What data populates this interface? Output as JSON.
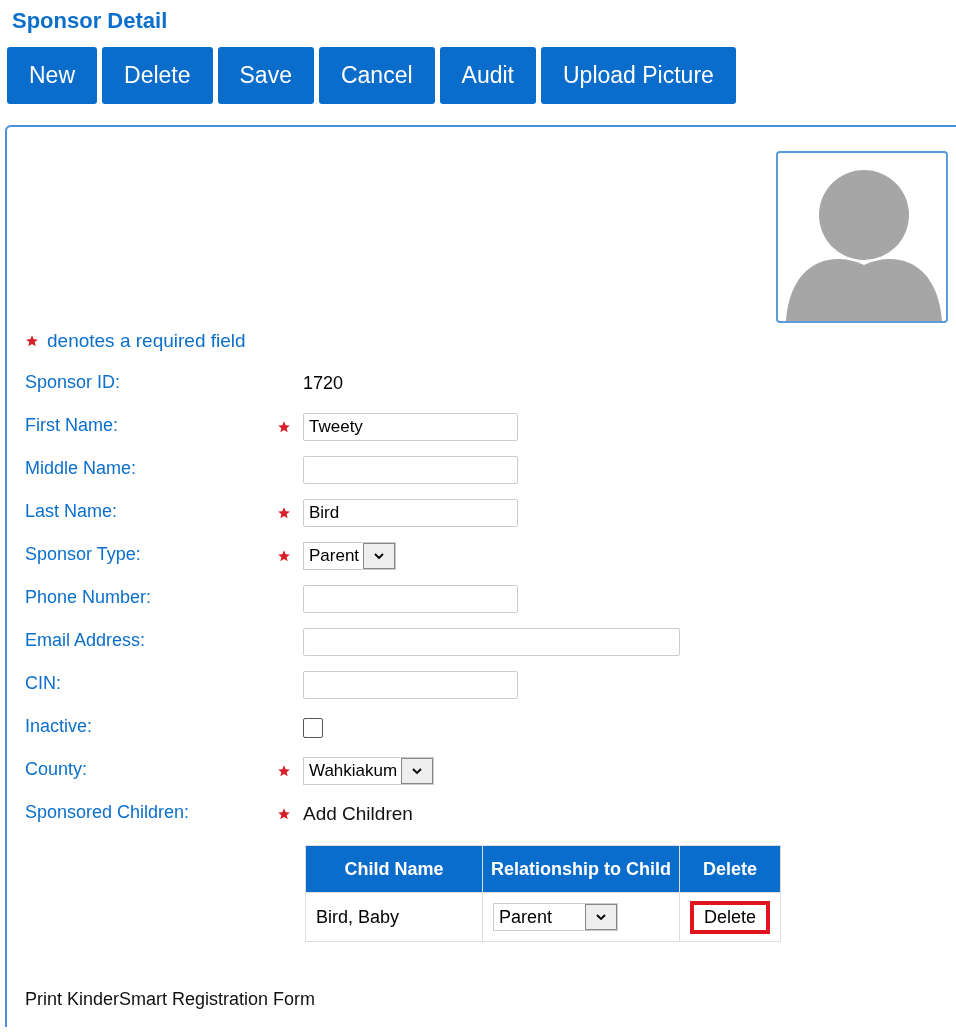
{
  "title": "Sponsor Detail",
  "toolbar": [
    "New",
    "Delete",
    "Save",
    "Cancel",
    "Audit",
    "Upload Picture"
  ],
  "required_note": "denotes a required field",
  "fields": [
    {
      "label": "Sponsor ID:",
      "kind": "static",
      "required": false,
      "value": "1720"
    },
    {
      "label": "First Name:",
      "kind": "text",
      "required": true,
      "value": "Tweety"
    },
    {
      "label": "Middle Name:",
      "kind": "text",
      "required": false
    },
    {
      "label": "Last Name:",
      "kind": "text",
      "required": true,
      "value": "Bird"
    },
    {
      "label": "Sponsor Type:",
      "kind": "select",
      "required": true,
      "value": "Parent"
    },
    {
      "label": "Phone Number:",
      "kind": "text",
      "required": false
    },
    {
      "label": "Email Address:",
      "kind": "longtext",
      "required": false
    },
    {
      "label": "CIN:",
      "kind": "text",
      "required": false
    },
    {
      "label": "Inactive:",
      "kind": "checkbox",
      "required": false,
      "checked": false
    },
    {
      "label": "County:",
      "kind": "select",
      "required": true,
      "value": "Wahkiakum"
    },
    {
      "label": "Sponsored Children:",
      "kind": "link",
      "required": true,
      "value": "Add Children"
    }
  ],
  "children_table": {
    "columns": [
      "Child Name",
      "Relationship to Child",
      "Delete"
    ],
    "rows": [
      {
        "child_name": "Bird, Baby",
        "relationship": "Parent",
        "delete": "Delete",
        "highlighted": true
      }
    ]
  },
  "print_link": "Print KinderSmart Registration Form"
}
